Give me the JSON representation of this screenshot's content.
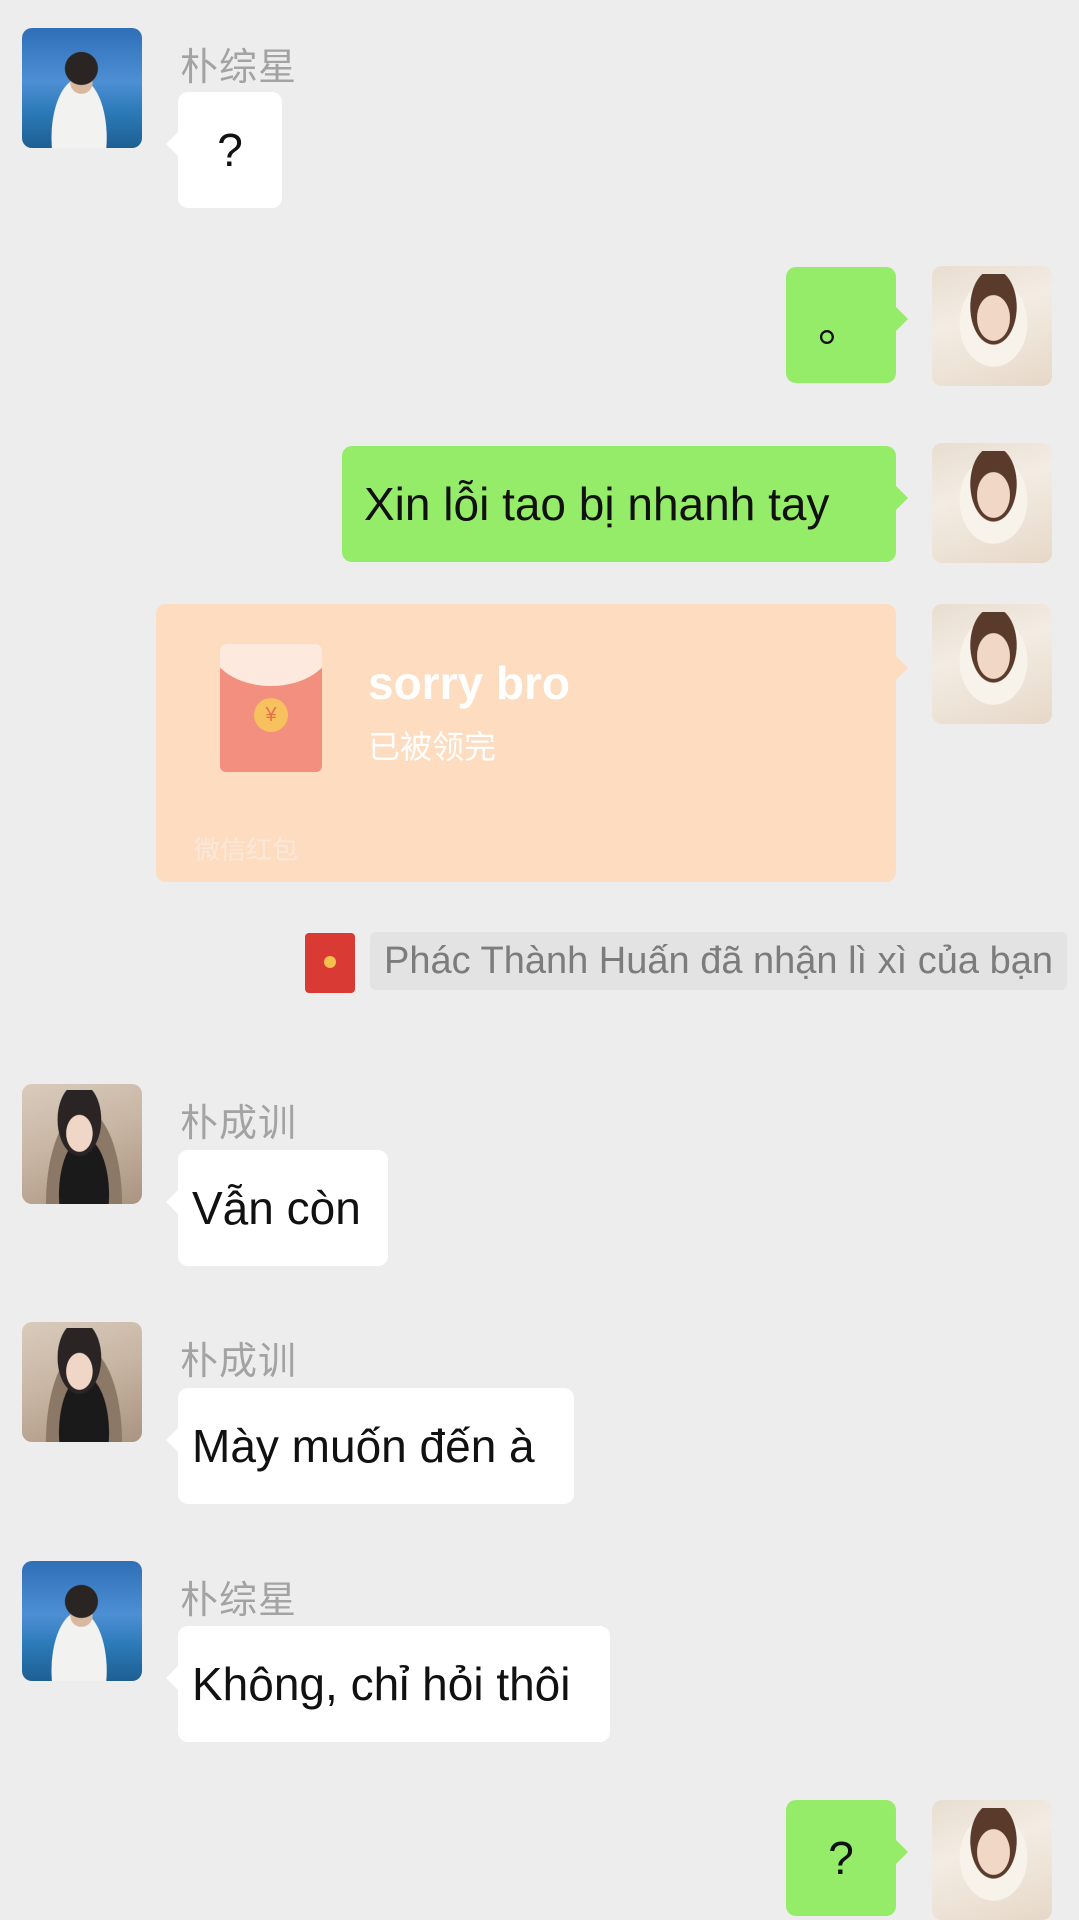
{
  "messages": [
    {
      "sender": "朴综星",
      "text": "?"
    },
    {
      "text": "。"
    },
    {
      "text": "Xin lỗi tao bị nhanh tay"
    },
    {
      "red_packet": {
        "title": "sorry bro",
        "status": "已被领完",
        "brand": "微信红包"
      }
    },
    {
      "system": "Phác Thành Huấn đã nhận lì xì của bạn"
    },
    {
      "sender": "朴成训",
      "text": "Vẫn còn"
    },
    {
      "sender": "朴成训",
      "text": "Mày muốn đến à"
    },
    {
      "sender": "朴综星",
      "text": "Không, chỉ hỏi thôi"
    },
    {
      "text": "?"
    }
  ],
  "colors": {
    "background": "#ededed",
    "own_bubble": "#95ec69",
    "other_bubble": "#ffffff",
    "red_packet": "#fddcbf",
    "sender_name": "#a3a3a3"
  },
  "icons": {
    "red_packet": "red-envelope-icon",
    "notice": "red-envelope-icon"
  }
}
